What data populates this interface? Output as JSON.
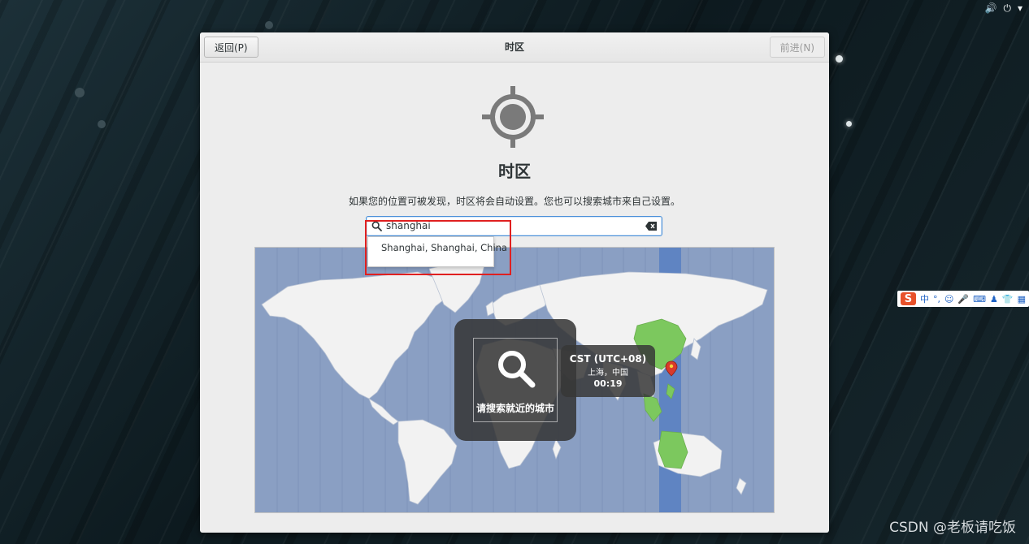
{
  "topbar": {
    "volume_icon": "volume-icon",
    "power_icon": "power-icon",
    "menu_icon": "chevron-down-icon"
  },
  "window": {
    "title": "时区",
    "back_label": "返回(P)",
    "next_label": "前进(N)"
  },
  "page": {
    "heading": "时区",
    "description": "如果您的位置可被发现，时区将会自动设置。您也可以搜索城市来自己设置。",
    "icon": "location-target-icon"
  },
  "search": {
    "value": "shanghai",
    "suggestion": "Shanghai, Shanghai, China"
  },
  "map": {
    "search_hint": "请搜索就近的城市",
    "timezone_abbr": "CST (UTC+08)",
    "timezone_city": "上海，中国",
    "timezone_time": "00:19",
    "colors": {
      "ocean": "#8a9fc3",
      "land": "#f2f2f2",
      "selected_zone": "#7cc85e",
      "selected_band": "#5f84c2"
    }
  },
  "ime": {
    "label": "中",
    "logo": "S"
  },
  "watermark": "CSDN @老板请吃饭"
}
